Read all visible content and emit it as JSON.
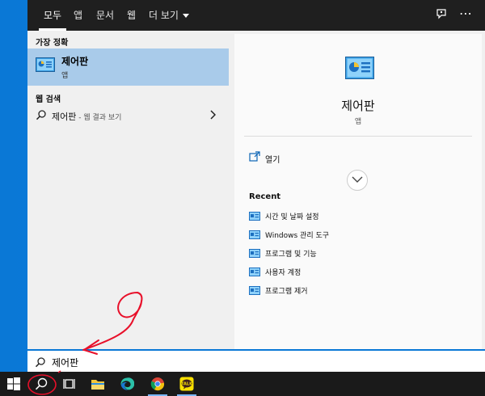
{
  "tabs": [
    {
      "label": "모두"
    },
    {
      "label": "앱"
    },
    {
      "label": "문서"
    },
    {
      "label": "웹"
    },
    {
      "label": "더 보기"
    }
  ],
  "left": {
    "best_match_title": "가장 정확",
    "best_match": {
      "name": "제어판",
      "type": "앱"
    },
    "web_search_title": "웹 검색",
    "web_result": {
      "query": "제어판",
      "suffix": " - 웹 결과 보기"
    }
  },
  "right": {
    "app_name": "제어판",
    "app_type": "앱",
    "open_label": "열기",
    "recent_title": "Recent",
    "recent_items": [
      {
        "label": "시간 및 날짜 설정"
      },
      {
        "label": "Windows 관리 도구"
      },
      {
        "label": "프로그램 및 기능"
      },
      {
        "label": "사용자 계정"
      },
      {
        "label": "프로그램 제거"
      }
    ]
  },
  "search": {
    "value": "제어판"
  },
  "colors": {
    "accent": "#0a78d6",
    "selected": "#a9cbea",
    "annotation": "#e8102a"
  },
  "icons": [
    "feedback-icon",
    "more-icon",
    "windows-start-icon",
    "search-icon",
    "task-view-icon",
    "file-explorer-icon",
    "edge-icon",
    "chrome-icon",
    "kakaotalk-icon"
  ]
}
